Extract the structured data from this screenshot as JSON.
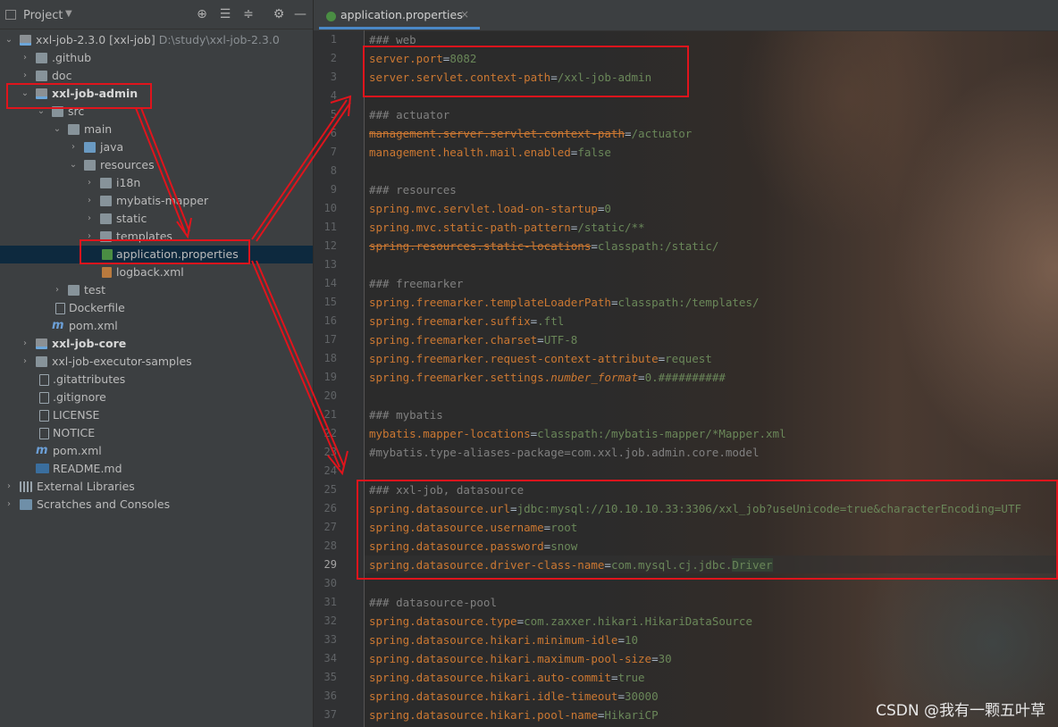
{
  "project": {
    "title": "Project",
    "tree": [
      {
        "label": "xxl-job-2.3.0 [xxl-job]",
        "suffix": "D:\\study\\xxl-job-2.3.0"
      },
      {
        "label": ".github"
      },
      {
        "label": "doc"
      },
      {
        "label": "xxl-job-admin"
      },
      {
        "label": "src"
      },
      {
        "label": "main"
      },
      {
        "label": "java"
      },
      {
        "label": "resources"
      },
      {
        "label": "i18n"
      },
      {
        "label": "mybatis-mapper"
      },
      {
        "label": "static"
      },
      {
        "label": "templates"
      },
      {
        "label": "application.properties"
      },
      {
        "label": "logback.xml"
      },
      {
        "label": "test"
      },
      {
        "label": "Dockerfile"
      },
      {
        "label": "pom.xml"
      },
      {
        "label": "xxl-job-core"
      },
      {
        "label": "xxl-job-executor-samples"
      },
      {
        "label": ".gitattributes"
      },
      {
        "label": ".gitignore"
      },
      {
        "label": "LICENSE"
      },
      {
        "label": "NOTICE"
      },
      {
        "label": "pom.xml"
      },
      {
        "label": "README.md"
      },
      {
        "label": "External Libraries"
      },
      {
        "label": "Scratches and Consoles"
      }
    ]
  },
  "editor": {
    "tab_label": "application.properties",
    "tab_close": "×",
    "current_line": 29,
    "lines": [
      {
        "n": "1",
        "type": "comment",
        "text": "### web"
      },
      {
        "n": "2",
        "type": "kv",
        "key": "server.port",
        "value": "8082"
      },
      {
        "n": "3",
        "type": "kv",
        "key": "server.servlet.context-path",
        "value": "/xxl-job-admin"
      },
      {
        "n": "4",
        "type": "blank"
      },
      {
        "n": "5",
        "type": "comment",
        "text": "### actuator"
      },
      {
        "n": "6",
        "type": "kv",
        "key": "management.server.servlet.context-path",
        "value": "/actuator",
        "strike": true
      },
      {
        "n": "7",
        "type": "kv",
        "key": "management.health.mail.enabled",
        "value": "false"
      },
      {
        "n": "8",
        "type": "blank"
      },
      {
        "n": "9",
        "type": "comment",
        "text": "### resources"
      },
      {
        "n": "10",
        "type": "kv",
        "key": "spring.mvc.servlet.load-on-startup",
        "value": "0"
      },
      {
        "n": "11",
        "type": "kv",
        "key": "spring.mvc.static-path-pattern",
        "value": "/static/**"
      },
      {
        "n": "12",
        "type": "kv",
        "key": "spring.resources.static-locations",
        "value": "classpath:/static/",
        "strike": true
      },
      {
        "n": "13",
        "type": "blank"
      },
      {
        "n": "14",
        "type": "comment",
        "text": "### freemarker"
      },
      {
        "n": "15",
        "type": "kv",
        "key": "spring.freemarker.templateLoaderPath",
        "value": "classpath:/templates/"
      },
      {
        "n": "16",
        "type": "kv",
        "key": "spring.freemarker.suffix",
        "value": ".ftl"
      },
      {
        "n": "17",
        "type": "kv",
        "key": "spring.freemarker.charset",
        "value": "UTF-8"
      },
      {
        "n": "18",
        "type": "kv",
        "key": "spring.freemarker.request-context-attribute",
        "value": "request"
      },
      {
        "n": "19",
        "type": "kv",
        "key": "spring.freemarker.settings.",
        "key2": "number_format",
        "value": "0.##########"
      },
      {
        "n": "20",
        "type": "blank"
      },
      {
        "n": "21",
        "type": "comment",
        "text": "### mybatis"
      },
      {
        "n": "22",
        "type": "kv",
        "key": "mybatis.mapper-locations",
        "value": "classpath:/mybatis-mapper/*Mapper.xml"
      },
      {
        "n": "23",
        "type": "comment",
        "text": "#mybatis.type-aliases-package=com.xxl.job.admin.core.model"
      },
      {
        "n": "24",
        "type": "blank"
      },
      {
        "n": "25",
        "type": "comment",
        "text": "### xxl-job, datasource"
      },
      {
        "n": "26",
        "type": "kv",
        "key": "spring.datasource.url",
        "value": "jdbc:mysql://10.10.10.33:3306/xxl_job?useUnicode=true&characterEncoding=UTF"
      },
      {
        "n": "27",
        "type": "kv",
        "key": "spring.datasource.username",
        "value": "root"
      },
      {
        "n": "28",
        "type": "kv",
        "key": "spring.datasource.password",
        "value": "snow"
      },
      {
        "n": "29",
        "type": "kv",
        "key": "spring.datasource.driver-class-name",
        "value": "com.mysql.cj.jdbc.",
        "value2": "Driver"
      },
      {
        "n": "30",
        "type": "blank"
      },
      {
        "n": "31",
        "type": "comment",
        "text": "### datasource-pool"
      },
      {
        "n": "32",
        "type": "kv",
        "key": "spring.datasource.type",
        "value": "com.zaxxer.hikari.HikariDataSource"
      },
      {
        "n": "33",
        "type": "kv",
        "key": "spring.datasource.hikari.minimum-idle",
        "value": "10"
      },
      {
        "n": "34",
        "type": "kv",
        "key": "spring.datasource.hikari.maximum-pool-size",
        "value": "30"
      },
      {
        "n": "35",
        "type": "kv",
        "key": "spring.datasource.hikari.auto-commit",
        "value": "true"
      },
      {
        "n": "36",
        "type": "kv",
        "key": "spring.datasource.hikari.idle-timeout",
        "value": "30000"
      },
      {
        "n": "37",
        "type": "kv",
        "key": "spring.datasource.hikari.pool-name",
        "value": "HikariCP"
      }
    ]
  },
  "watermark": "CSDN @我有一颗五叶草",
  "colors": {
    "annotation": "#e0141c",
    "key": "#cc7832",
    "value": "#6a8759",
    "comment": "#808080"
  }
}
